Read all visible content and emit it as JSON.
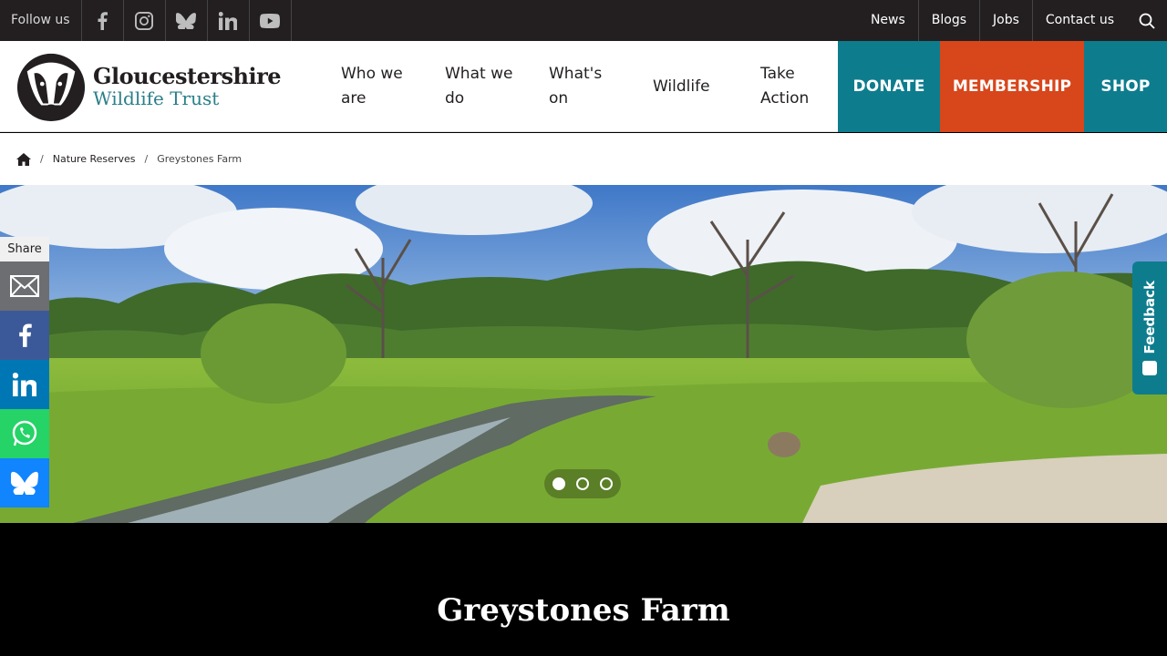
{
  "topbar": {
    "follow_label": "Follow us",
    "social_icons": [
      "facebook-icon",
      "instagram-icon",
      "bluesky-icon",
      "linkedin-icon",
      "youtube-icon"
    ],
    "links": [
      "News",
      "Blogs",
      "Jobs",
      "Contact us"
    ]
  },
  "header": {
    "logo": {
      "line1": "Gloucestershire",
      "line2": "Wildlife Trust"
    },
    "nav": [
      {
        "label": "Who we are"
      },
      {
        "label": "What we do"
      },
      {
        "label": "What's on"
      },
      {
        "label": "Wildlife"
      },
      {
        "label": "Take Action"
      }
    ],
    "cta": {
      "donate": "DONATE",
      "membership": "MEMBERSHIP",
      "shop": "SHOP"
    }
  },
  "breadcrumb": {
    "level1": "Nature Reserves",
    "current": "Greystones Farm"
  },
  "share": {
    "label": "Share"
  },
  "carousel": {
    "slides": 3,
    "active_index": 0
  },
  "feedback": {
    "label": "Feedback"
  },
  "page": {
    "title": "Greystones Farm"
  },
  "colors": {
    "teal": "#0d7d8e",
    "orange": "#d8461b",
    "topbar": "#231f20"
  }
}
